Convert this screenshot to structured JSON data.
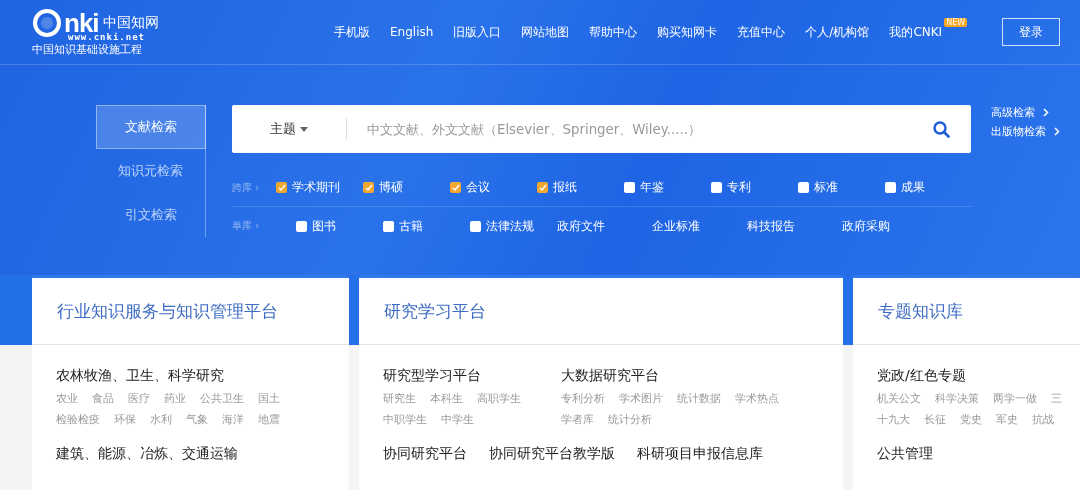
{
  "logo": {
    "wordmark": "nki",
    "name": "中国知网",
    "url": "www.cnki.net",
    "slogan": "中国知识基础设施工程"
  },
  "nav": [
    {
      "label": "手机版"
    },
    {
      "label": "English"
    },
    {
      "label": "旧版入口"
    },
    {
      "label": "网站地图"
    },
    {
      "label": "帮助中心"
    },
    {
      "label": "购买知网卡"
    },
    {
      "label": "充值中心"
    },
    {
      "label": "个人/机构馆"
    },
    {
      "label": "我的CNKI",
      "badge": "NEW"
    }
  ],
  "login_button": "登录",
  "search_tabs": [
    {
      "label": "文献检索",
      "selected": true
    },
    {
      "label": "知识元检索",
      "selected": false
    },
    {
      "label": "引文检索",
      "selected": false
    }
  ],
  "search": {
    "field": "主题",
    "placeholder": "中文文献、外文文献（Elsevier、Springer、Wiley.....）"
  },
  "search_links": [
    "高级检索",
    "出版物检索"
  ],
  "db_rows": [
    {
      "label": "跨库",
      "arrow": "›",
      "items": [
        {
          "kind": "checkbox",
          "label": "学术期刊",
          "checked": true
        },
        {
          "kind": "checkbox",
          "label": "博硕",
          "checked": true
        },
        {
          "kind": "checkbox",
          "label": "会议",
          "checked": true
        },
        {
          "kind": "checkbox",
          "label": "报纸",
          "checked": true
        },
        {
          "kind": "checkbox",
          "label": "年鉴",
          "checked": false
        },
        {
          "kind": "checkbox",
          "label": "专利",
          "checked": false
        },
        {
          "kind": "checkbox",
          "label": "标准",
          "checked": false
        },
        {
          "kind": "checkbox",
          "label": "成果",
          "checked": false
        }
      ]
    },
    {
      "label": "单库",
      "arrow": "›",
      "items": [
        {
          "kind": "checkbox",
          "label": "图书",
          "checked": false
        },
        {
          "kind": "checkbox",
          "label": "古籍",
          "checked": false
        },
        {
          "kind": "checkbox",
          "label": "法律法规",
          "checked": false
        },
        {
          "kind": "link",
          "label": "政府文件"
        },
        {
          "kind": "link",
          "label": "企业标准"
        },
        {
          "kind": "link",
          "label": "科技报告"
        },
        {
          "kind": "link",
          "label": "政府采购"
        }
      ]
    }
  ],
  "cards": [
    {
      "kind": "stacked",
      "title": "行业知识服务与知识管理平台",
      "groups": [
        {
          "heading": "农林牧渔、卫生、科学研究",
          "tag_rows": [
            [
              "农业",
              "食品",
              "医疗",
              "药业",
              "公共卫生",
              "国土"
            ],
            [
              "检验检疫",
              "环保",
              "水利",
              "气象",
              "海洋",
              "地震"
            ]
          ]
        },
        {
          "heading": "建筑、能源、冶炼、交通运输"
        }
      ]
    },
    {
      "kind": "split",
      "title": "研究学习平台",
      "groups": [
        {
          "heading": "研究型学习平台",
          "tag_rows": [
            [
              "研究生",
              "本科生",
              "高职学生"
            ],
            [
              "中职学生",
              "中学生"
            ]
          ]
        },
        {
          "heading": "大数据研究平台",
          "tag_rows": [
            [
              "专利分析",
              "学术图片",
              "统计数据",
              "学术热点"
            ],
            [
              "学者库",
              "统计分析"
            ]
          ]
        }
      ],
      "links": [
        "协同研究平台",
        "协同研究平台教学版",
        "科研项目申报信息库"
      ]
    },
    {
      "kind": "stacked",
      "title": "专题知识库",
      "groups": [
        {
          "heading": "党政/红色专题",
          "tag_rows": [
            [
              "机关公文",
              "科学决策",
              "两学一做",
              "三"
            ],
            [
              "十九大",
              "长征",
              "党史",
              "军史",
              "抗战"
            ]
          ]
        },
        {
          "heading": "公共管理"
        }
      ]
    }
  ]
}
